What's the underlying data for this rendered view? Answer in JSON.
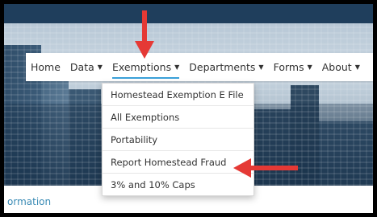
{
  "nav": {
    "items": [
      {
        "label": "Home",
        "caret": false
      },
      {
        "label": "Data",
        "caret": true
      },
      {
        "label": "Exemptions",
        "caret": true,
        "active": true
      },
      {
        "label": "Departments",
        "caret": true
      },
      {
        "label": "Forms",
        "caret": true
      },
      {
        "label": "About",
        "caret": true
      }
    ],
    "caret_glyph": "▼"
  },
  "dropdown": {
    "items": [
      "Homestead Exemption E File",
      "All Exemptions",
      "Portability",
      "Report Homestead Fraud",
      "3% and 10% Caps"
    ]
  },
  "footer": {
    "partial_link": "ormation"
  },
  "colors": {
    "annotation_arrow": "#e53935",
    "active_underline": "#3aa0d8",
    "link": "#3a8bb5",
    "top_strip": "#1f3e5c"
  }
}
